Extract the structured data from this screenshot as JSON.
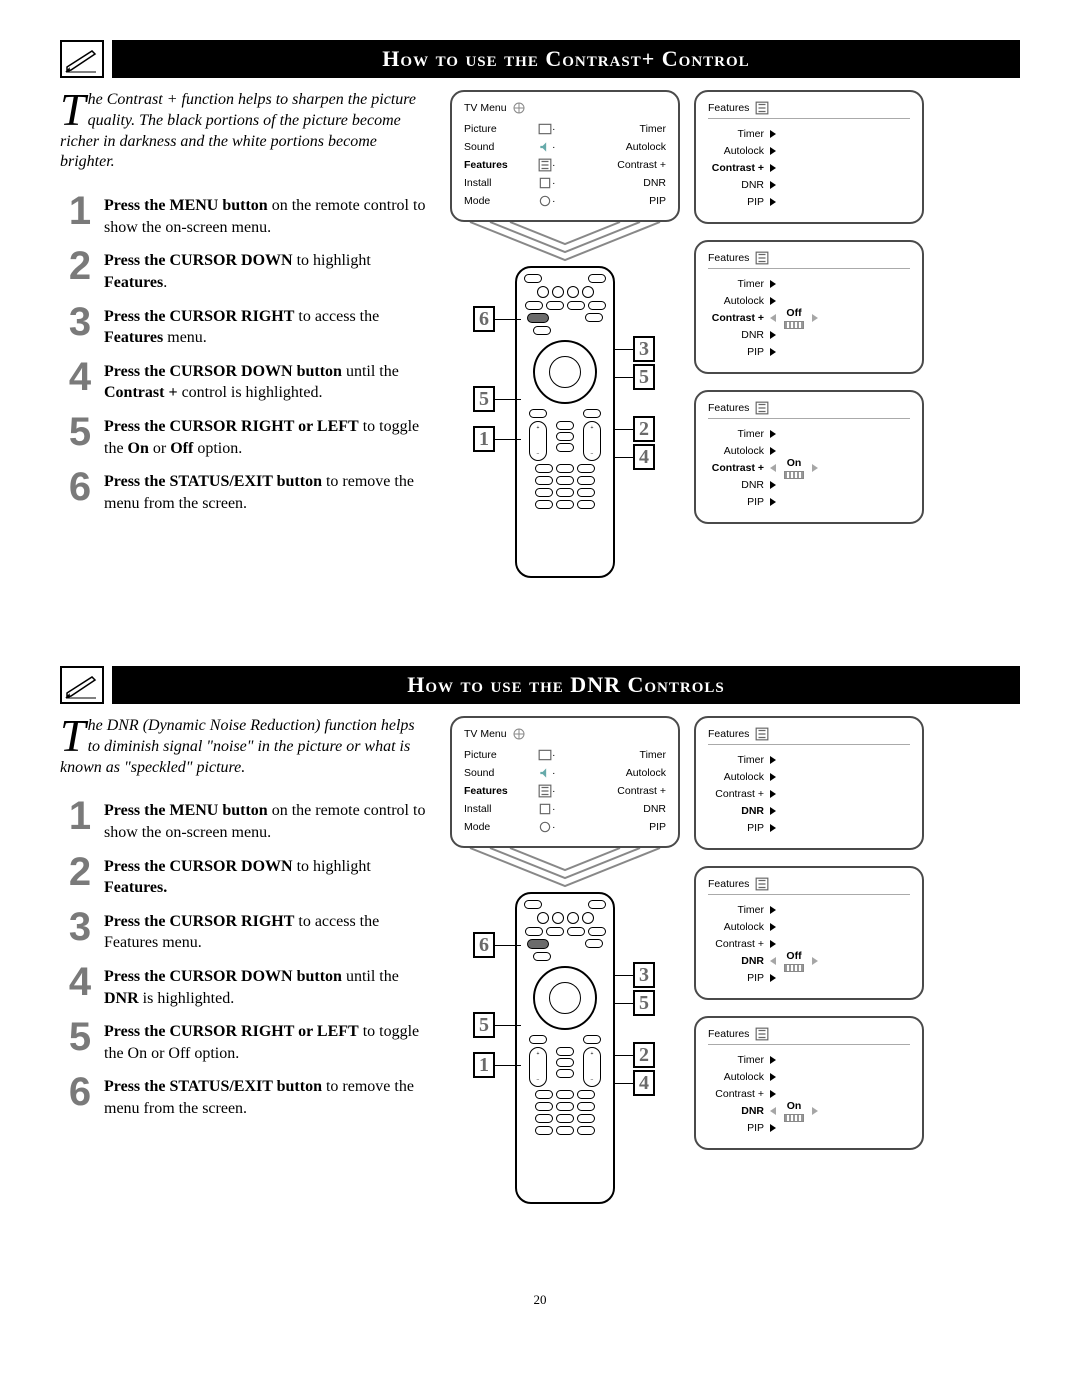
{
  "page_number": "20",
  "section1": {
    "title": "How to use the Contrast+ Control",
    "intro_first": "T",
    "intro_rest": "he Contrast + function helps to sharpen the picture quality. The black portions of the picture become richer in darkness and the white portions become brighter.",
    "steps": [
      {
        "n": "1",
        "bold": "Press the MENU button",
        "rest": " on the remote control to show the on-screen menu."
      },
      {
        "n": "2",
        "bold": "Press the CURSOR DOWN",
        "rest": " to highlight ",
        "bold2": "Features",
        "rest2": "."
      },
      {
        "n": "3",
        "bold": "Press the CURSOR RIGHT",
        "rest": " to access the ",
        "bold2": "Features",
        "rest2": " menu."
      },
      {
        "n": "4",
        "bold": "Press the CURSOR DOWN button",
        "rest": " until the ",
        "bold2": "Contrast +",
        "rest2": " control is highlighted."
      },
      {
        "n": "5",
        "bold": "Press the CURSOR RIGHT or LEFT",
        "rest": " to toggle the ",
        "bold2": "On",
        "rest2": " or ",
        "bold3": "Off",
        "rest3": " option."
      },
      {
        "n": "6",
        "bold": "Press the STATUS/EXIT button",
        "rest": " to remove the menu from the screen."
      }
    ],
    "tv": {
      "title": "TV Menu",
      "left": [
        "Picture",
        "Sound",
        "Features",
        "Install",
        "Mode"
      ],
      "left_highlight": "Features",
      "right": [
        "Timer",
        "Autolock",
        "Contrast +",
        "DNR",
        "PIP"
      ]
    },
    "panels_title": "Features",
    "panel_items": [
      "Timer",
      "Autolock",
      "Contrast +",
      "DNR",
      "PIP"
    ],
    "panel_highlight": "Contrast +",
    "panel2_val": "Off",
    "panel3_val": "On",
    "callouts": [
      "6",
      "5",
      "1",
      "3",
      "5",
      "2",
      "4"
    ]
  },
  "section2": {
    "title": "How to use the DNR Controls",
    "intro_first": "T",
    "intro_rest": "he DNR (Dynamic Noise Reduction) function helps to diminish signal \"noise\" in the picture or what is known as \"speckled\" picture.",
    "steps": [
      {
        "n": "1",
        "bold": "Press the MENU button",
        "rest": " on the remote control to show the on-screen menu."
      },
      {
        "n": "2",
        "bold": "Press the CURSOR DOWN",
        "rest": " to highlight ",
        "bold2": "Features.",
        "rest2": ""
      },
      {
        "n": "3",
        "bold": "Press the CURSOR RIGHT",
        "rest": " to access the Features menu."
      },
      {
        "n": "4",
        "bold": "Press the CURSOR DOWN button",
        "rest": " until the ",
        "bold2": "DNR",
        "rest2": " is highlighted."
      },
      {
        "n": "5",
        "bold": "Press the CURSOR RIGHT or LEFT",
        "rest": " to toggle the On or Off option."
      },
      {
        "n": "6",
        "bold": "Press the STATUS/EXIT button",
        "rest": " to remove the menu from the screen."
      }
    ],
    "tv": {
      "title": "TV Menu",
      "left": [
        "Picture",
        "Sound",
        "Features",
        "Install",
        "Mode"
      ],
      "left_highlight": "Features",
      "right": [
        "Timer",
        "Autolock",
        "Contrast +",
        "DNR",
        "PIP"
      ]
    },
    "panels_title": "Features",
    "panel_items": [
      "Timer",
      "Autolock",
      "Contrast +",
      "DNR",
      "PIP"
    ],
    "panel_highlight": "DNR",
    "panel2_val": "Off",
    "panel3_val": "On"
  }
}
